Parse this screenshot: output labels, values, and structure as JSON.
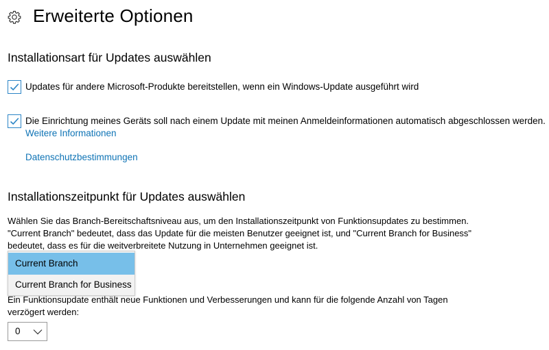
{
  "header": {
    "title": "Erweiterte Optionen",
    "icon": "gear-icon"
  },
  "install_type": {
    "heading": "Installationsart für Updates auswählen",
    "options": [
      {
        "label": "Updates für andere Microsoft-Produkte bereitstellen, wenn ein Windows-Update ausgeführt wird",
        "checked": true
      },
      {
        "label": "Die Einrichtung meines Geräts soll nach einem Update mit meinen Anmeldeinformationen automatisch abgeschlossen werden.",
        "checked": true
      }
    ],
    "more_info_link": "Weitere Informationen",
    "privacy_link": "Datenschutzbestimmungen"
  },
  "install_time": {
    "heading": "Installationszeitpunkt für Updates auswählen",
    "description_lines": [
      "Wählen Sie das Branch-Bereitschaftsniveau aus, um den Installationszeitpunkt von Funktionsupdates zu bestimmen.",
      "\"Current Branch\" bedeutet, dass das Update für die meisten Benutzer geeignet ist, und \"Current Branch for Business\"",
      "bedeutet, dass es für die weitverbreitete Nutzung in Unternehmen geeignet ist."
    ],
    "branch_options": [
      "Current Branch",
      "Current Branch for Business"
    ],
    "branch_selected": "Current Branch",
    "feature_update_lines": [
      "Ein Funktionsupdate enthält neue Funktionen und Verbesserungen und kann für die folgende Anzahl von Tagen",
      "verzögert werden:"
    ],
    "days_value": "0"
  },
  "colors": {
    "accent": "#2a84c6",
    "link": "#0e73b5",
    "selected_option": "#77bfe9"
  }
}
